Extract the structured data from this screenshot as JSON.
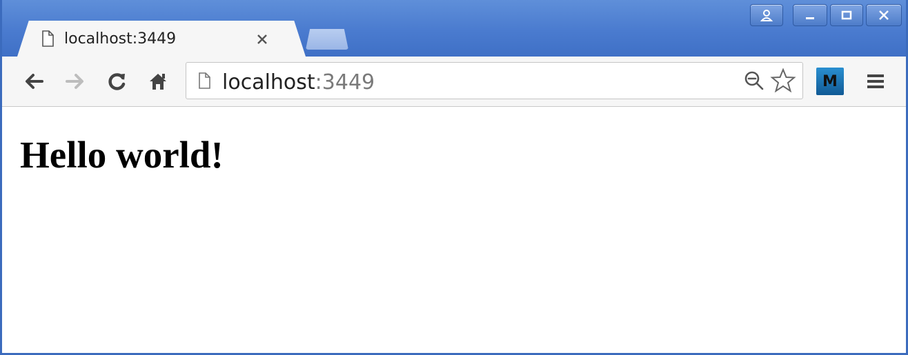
{
  "tab": {
    "title": "localhost:3449"
  },
  "address_bar": {
    "host": "localhost",
    "port": ":3449"
  },
  "extension": {
    "label": "M",
    "color": "#1a6fb5"
  },
  "page": {
    "heading": "Hello world!"
  },
  "colors": {
    "titlebar": "#4a7bcf",
    "toolbar": "#f6f6f6"
  },
  "icons": [
    "page-icon",
    "close-icon",
    "back-icon",
    "forward-icon",
    "reload-icon",
    "home-icon",
    "zoom-out-icon",
    "star-icon",
    "menu-icon",
    "user-icon",
    "minimize-icon",
    "maximize-icon",
    "window-close-icon"
  ]
}
